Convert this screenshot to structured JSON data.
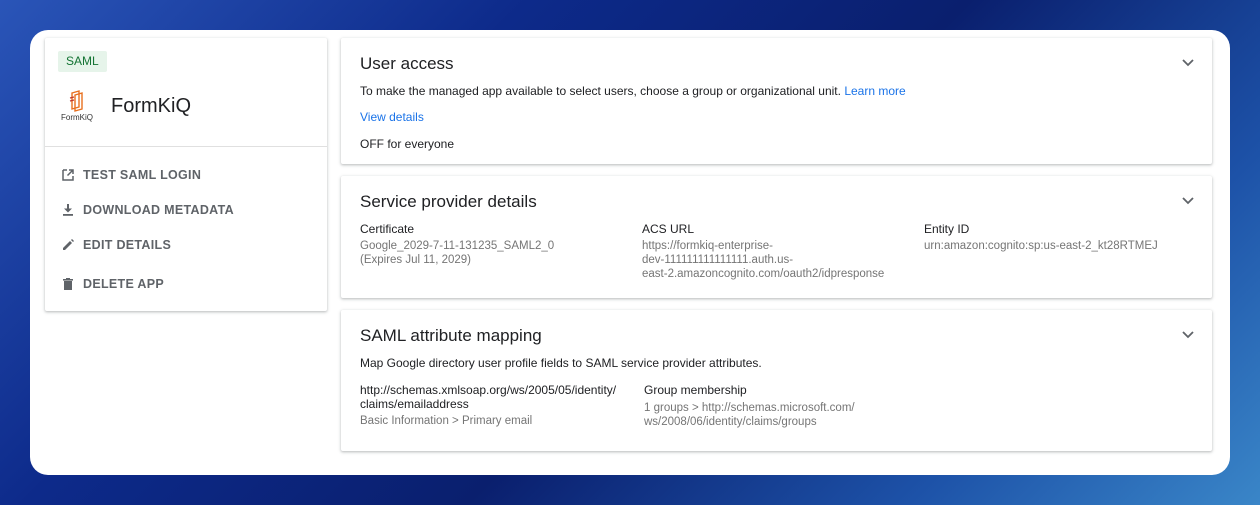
{
  "left_panel": {
    "badge": "SAML",
    "logo_word": "FormKiQ",
    "app_name": "FormKiQ",
    "actions": [
      {
        "label": "TEST SAML LOGIN",
        "icon": "open-in-new-icon"
      },
      {
        "label": "DOWNLOAD METADATA",
        "icon": "download-icon"
      },
      {
        "label": "EDIT DETAILS",
        "icon": "pencil-icon"
      },
      {
        "label": "DELETE APP",
        "icon": "trash-icon"
      }
    ]
  },
  "user_access": {
    "title": "User access",
    "description": "To make the managed app available to select users, choose a group or organizational unit.",
    "learn_more": "Learn more",
    "view_details": "View details",
    "status": "OFF for everyone"
  },
  "service_provider": {
    "title": "Service provider details",
    "certificate_label": "Certificate",
    "certificate_value": "Google_2029-7-11-131235_SAML2_0",
    "certificate_expiry": "(Expires Jul 11, 2029)",
    "acs_label": "ACS URL",
    "acs_line1": "https://formkiq-enterprise-",
    "acs_line2": "dev-111111111111111.auth.us-",
    "acs_line3": "east-2.amazoncognito.com/oauth2/idpresponse",
    "entity_label": "Entity ID",
    "entity_value": "urn:amazon:cognito:sp:us-east-2_kt28RTMEJ"
  },
  "saml_mapping": {
    "title": "SAML attribute mapping",
    "description": "Map Google directory user profile fields to SAML service provider attributes.",
    "attr1_line1": "http://schemas.xmlsoap.org/ws/2005/05/identity/",
    "attr1_line2": "claims/emailaddress",
    "attr1_value": "Basic Information > Primary email",
    "attr2_label": "Group membership",
    "attr2_line1": "1 groups > http://schemas.microsoft.com/",
    "attr2_line2": "ws/2008/06/identity/claims/groups"
  },
  "colors": {
    "accent_link": "#1a73e8",
    "badge_bg": "#e6f4ea",
    "badge_text": "#137333",
    "logo_orange": "#e8701f"
  }
}
